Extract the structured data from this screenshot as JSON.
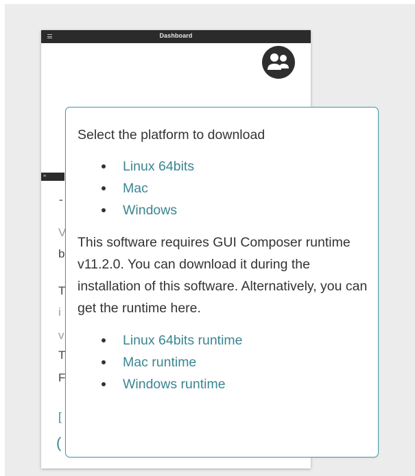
{
  "window": {
    "title": "Dashboard",
    "inner_bar_label": "≡"
  },
  "popup": {
    "heading": "Select the platform to download",
    "platform_links": [
      "Linux 64bits",
      "Mac",
      "Windows"
    ],
    "requirement_text": "This software requires GUI Composer runtime v11.2.0. You can download it during the installation of this software. Alternatively, you can get the runtime here.",
    "runtime_links": [
      "Linux 64bits runtime",
      "Mac runtime",
      "Windows runtime"
    ]
  },
  "colors": {
    "link": "#3a8591",
    "popup_border": "#3c9aa6",
    "title_bar": "#2b2b2b"
  },
  "icons": {
    "menu": "menu-icon",
    "users": "users-icon",
    "bullet": "bullet-dot"
  }
}
